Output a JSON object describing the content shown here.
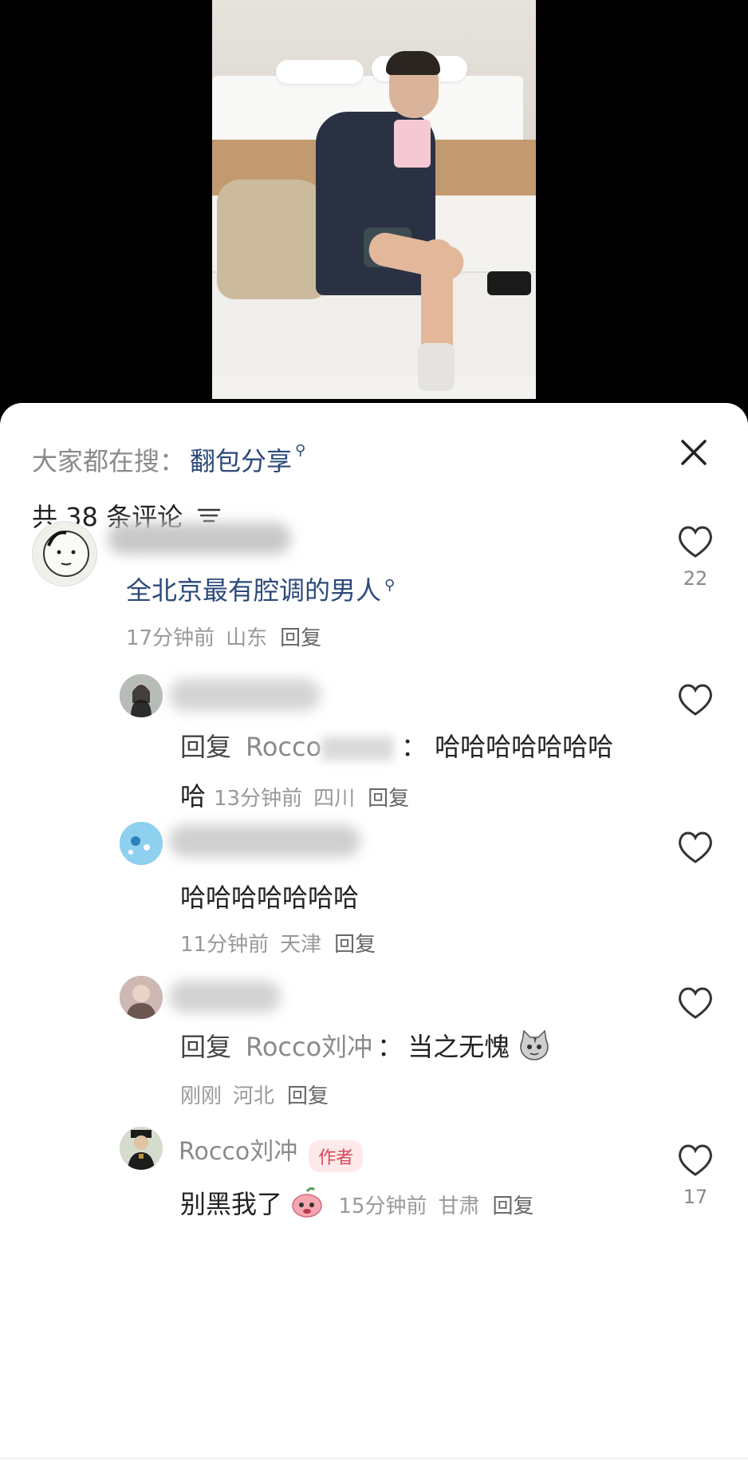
{
  "search": {
    "prefix": "大家都在搜：",
    "term": "翻包分享",
    "search_glyph": "⚲"
  },
  "header": {
    "count_text": "共 38 条评论"
  },
  "comments": [
    {
      "text": "全北京最有腔调的男人",
      "link_glyph": "⚲",
      "time": "17分钟前",
      "region": "山东",
      "reply": "回复",
      "likes": "22"
    },
    {
      "reply_tag": "回复",
      "reply_to": "Rocco",
      "reply_colon": "：",
      "text_line1": "哈哈哈哈哈哈哈",
      "text_line2": "哈",
      "time": "13分钟前",
      "region": "四川",
      "reply": "回复"
    },
    {
      "text": "哈哈哈哈哈哈哈",
      "time": "11分钟前",
      "region": "天津",
      "reply": "回复"
    },
    {
      "reply_tag": "回复",
      "reply_to": "Rocco刘冲",
      "reply_colon": "：",
      "text": "当之无愧",
      "time": "刚刚",
      "region": "河北",
      "reply": "回复"
    },
    {
      "author": "Rocco刘冲",
      "badge": "作者",
      "text": "别黑我了",
      "time": "15分钟前",
      "region": "甘肃",
      "reply": "回复",
      "likes": "17"
    }
  ],
  "colors": {
    "link": "#2c4a7a",
    "meta": "#999999",
    "badge_bg": "#fde8ea",
    "badge_text": "#d9485c"
  },
  "icons": [
    "close-icon",
    "filter-icon",
    "heart-icon",
    "search-icon",
    "cat-emoji-icon",
    "peach-emoji-icon"
  ]
}
